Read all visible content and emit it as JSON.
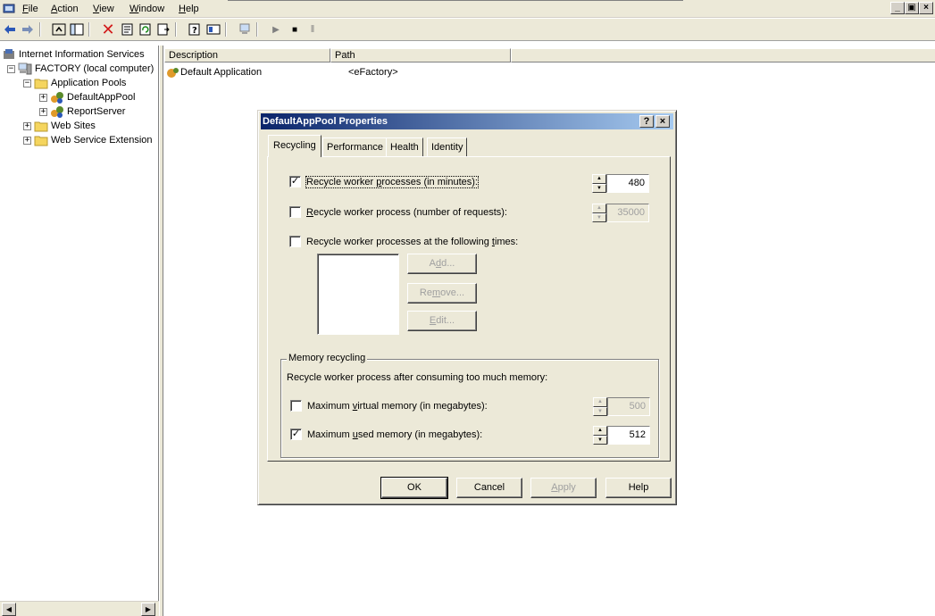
{
  "menubar": {
    "items": [
      {
        "label": "File",
        "mnemonic": "F",
        "rest": "ile"
      },
      {
        "label": "Action",
        "mnemonic": "A",
        "rest": "ction"
      },
      {
        "label": "View",
        "mnemonic": "V",
        "rest": "iew"
      },
      {
        "label": "Window",
        "mnemonic": "W",
        "rest": "indow"
      },
      {
        "label": "Help",
        "mnemonic": "H",
        "rest": "elp"
      }
    ],
    "window_buttons": [
      "_",
      "▣",
      "×"
    ]
  },
  "toolbar": {
    "icons": [
      "back-arrow-icon",
      "forward-arrow-icon",
      "up-folder-icon",
      "show-hide-tree-icon",
      "delete-icon",
      "properties-icon",
      "refresh-icon",
      "export-list-icon",
      "help-icon",
      "console-tree-icon",
      "computer-icon",
      "play-icon",
      "stop-icon",
      "pause-icon"
    ]
  },
  "tree": {
    "root": "Internet Information Services",
    "computer": "FACTORY (local computer)",
    "app_pools": "Application Pools",
    "pool1": "DefaultAppPool",
    "pool2": "ReportServer",
    "web_sites": "Web Sites",
    "web_ext": "Web Service Extension"
  },
  "list": {
    "columns": [
      "Description",
      "Path"
    ],
    "rows": [
      {
        "description": "Default Application",
        "path": "<eFactory>"
      }
    ]
  },
  "dialog": {
    "title": "DefaultAppPool Properties",
    "help_btn": "?",
    "close_btn": "×",
    "tabs": [
      "Recycling",
      "Performance",
      "Health",
      "Identity"
    ],
    "active_tab": "Recycling",
    "recycle_minutes": {
      "pre": "Recycle worker ",
      "ul": "p",
      "post": "rocesses (in minutes):",
      "checked": true,
      "value": "480"
    },
    "recycle_requests": {
      "pre": "",
      "ul": "R",
      "post": "ecycle worker process (number of requests):",
      "checked": false,
      "value": "35000"
    },
    "recycle_times": {
      "pre": "Recycle worker processes at the following ",
      "ul": "t",
      "post": "imes:",
      "checked": false
    },
    "add_btn": {
      "pre": "A",
      "ul": "d",
      "post": "d..."
    },
    "remove_btn": {
      "pre": "Re",
      "ul": "m",
      "post": "ove..."
    },
    "edit_btn": {
      "pre": "",
      "ul": "E",
      "post": "dit..."
    },
    "memory_group": "Memory recycling",
    "memory_desc": "Recycle worker process after consuming too much memory:",
    "max_virtual": {
      "pre": "Maximum ",
      "ul": "v",
      "post": "irtual memory (in megabytes):",
      "checked": false,
      "value": "500"
    },
    "max_used": {
      "pre": "Maximum ",
      "ul": "u",
      "post": "sed memory (in megabytes):",
      "checked": true,
      "value": "512"
    },
    "ok": "OK",
    "cancel": "Cancel",
    "apply": {
      "pre": "",
      "ul": "A",
      "post": "pply"
    },
    "help": "Help",
    "check_mark": "✓"
  },
  "colors": {
    "title_start": "#0a246a",
    "title_end": "#a6caf0",
    "chrome": "#ece9d8"
  }
}
